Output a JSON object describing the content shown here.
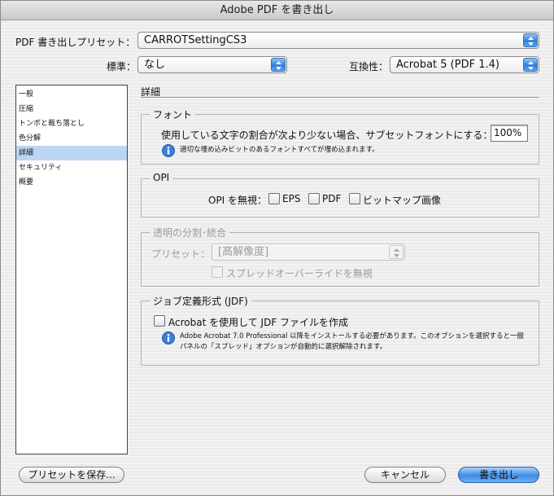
{
  "window": {
    "title": "Adobe PDF を書き出し"
  },
  "preset": {
    "label": "PDF 書き出しプリセット：",
    "value": "CARROTSettingCS3"
  },
  "standard": {
    "label": "標準：",
    "value": "なし"
  },
  "compat": {
    "label": "互換性：",
    "value": "Acrobat 5 (PDF 1.4)"
  },
  "sidebar": {
    "items": [
      {
        "label": "一般"
      },
      {
        "label": "圧縮"
      },
      {
        "label": "トンボと裁ち落とし"
      },
      {
        "label": "色分解"
      },
      {
        "label": "詳細"
      },
      {
        "label": "セキュリティ"
      },
      {
        "label": "概要"
      }
    ],
    "selected_index": 4
  },
  "section": {
    "title": "詳細"
  },
  "font_group": {
    "title": "フォント",
    "subset_label": "使用している文字の割合が次より少ない場合、サブセットフォントにする：",
    "subset_value": "100%",
    "info": "適切な埋め込みビットのあるフォントすべてが埋め込まれます。"
  },
  "opi_group": {
    "title": "OPI",
    "ignore_label": "OPI を無視：",
    "eps_label": "EPS",
    "pdf_label": "PDF",
    "bitmap_label": "ビットマップ画像"
  },
  "flatten_group": {
    "title": "透明の分割･統合",
    "preset_label": "プリセット：",
    "preset_value": "[高解像度]",
    "override_label": "スプレッドオーバーライドを無視"
  },
  "jdf_group": {
    "title": "ジョブ定義形式 (JDF)",
    "create_label": "Acrobat を使用して JDF ファイルを作成",
    "info_line1": "Adobe Acrobat 7.0 Professional 以降をインストールする必要があります。このオプションを選択すると一般",
    "info_line2": "パネルの「スプレッド」オプションが自動的に選択解除されます。"
  },
  "buttons": {
    "save_preset": "プリセットを保存...",
    "cancel": "キャンセル",
    "export": "書き出し"
  },
  "colors": {
    "accent": "#3f8ae3",
    "selection": "#bcd5f4"
  }
}
